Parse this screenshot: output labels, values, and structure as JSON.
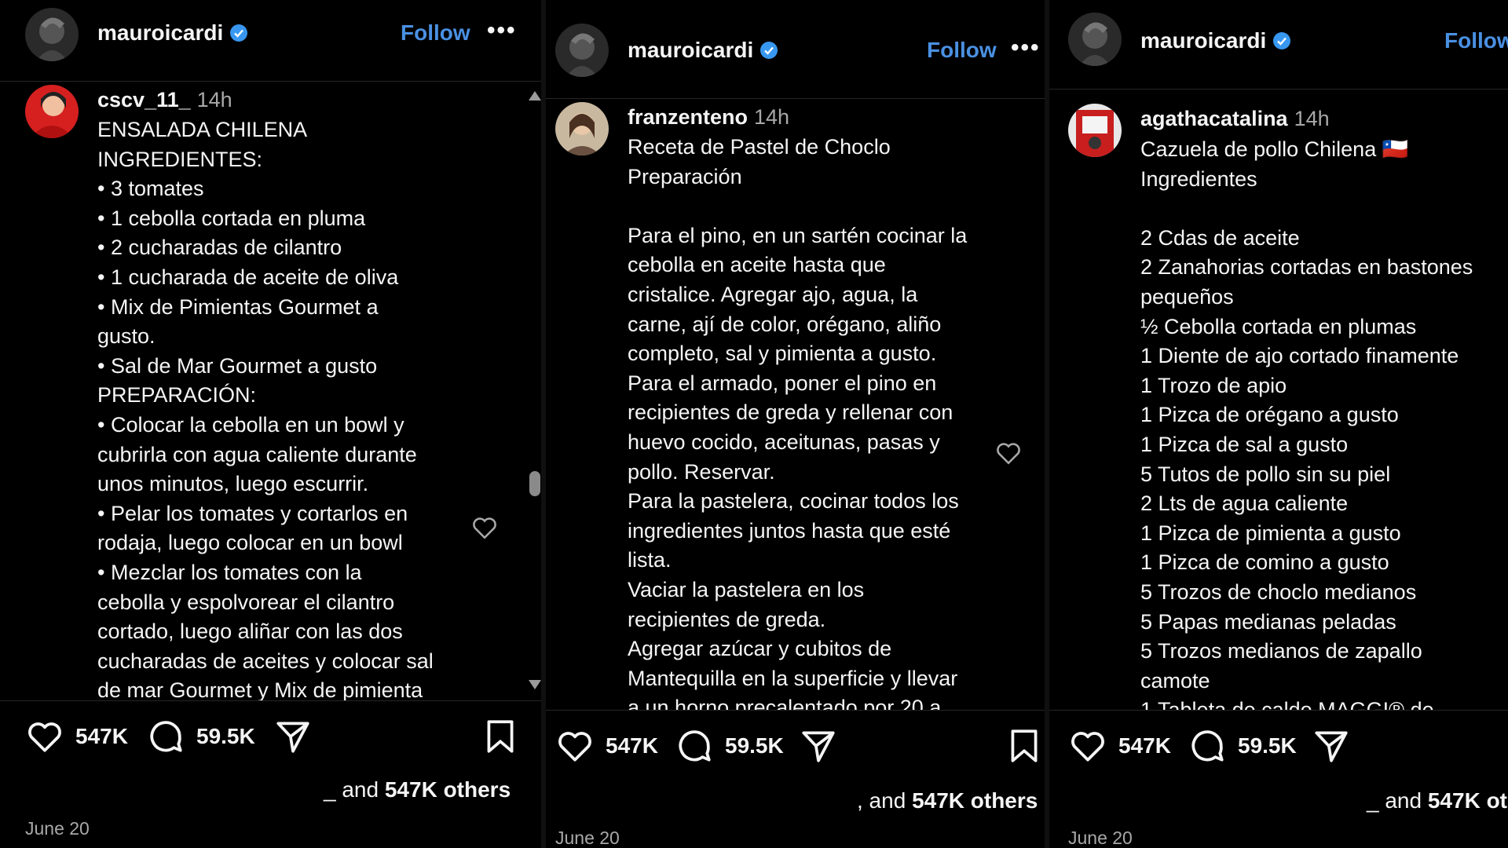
{
  "panels": [
    {
      "post_author": "mauroicardi",
      "follow_label": "Follow",
      "more_label": "•••",
      "comment": {
        "user": "cscv_11_",
        "time": "14h",
        "text": "ENSALADA CHILENA\nINGREDIENTES:\n• 3 tomates\n• 1 cebolla cortada en pluma\n• 2 cucharadas de cilantro\n• 1 cucharada de aceite de oliva\n• Mix de Pimientas Gourmet a\ngusto.\n• Sal de Mar Gourmet a gusto\nPREPARACIÓN:\n• Colocar la cebolla en un bowl y\ncubrirla con agua caliente durante\nunos minutos, luego escurrir.\n• Pelar los tomates y cortarlos en\nrodaja, luego colocar en un bowl\n• Mezclar los tomates con la\ncebolla y espolvorear el cilantro\ncortado, luego aliñar con las dos\ncucharadas de aceites y colocar sal\nde mar Gourmet y Mix de pimienta"
      },
      "likes": "547K",
      "comments_count": "59.5K",
      "liked_by_prefix": "_ and ",
      "liked_by_count": "547K others",
      "date": "June 20"
    },
    {
      "post_author": "mauroicardi",
      "follow_label": "Follow",
      "more_label": "•••",
      "comment": {
        "user": "franzenteno",
        "time": "14h",
        "text": "Receta de Pastel de Choclo\nPreparación\n\nPara el pino, en un sartén cocinar la\ncebolla en aceite hasta que\ncristalice. Agregar ajo, agua, la\ncarne, ají de color, orégano, aliño\ncompleto, sal y pimienta a gusto.\nPara el armado, poner el pino en\nrecipientes de greda y rellenar con\nhuevo cocido, aceitunas, pasas y\npollo. Reservar.\nPara la pastelera, cocinar todos los\ningredientes juntos hasta que esté\nlista.\nVaciar la pastelera en los\nrecipientes de greda.\nAgregar azúcar y cubitos de\nMantequilla en la superficie y llevar\na un horno precalentado por 20 a"
      },
      "likes": "547K",
      "comments_count": "59.5K",
      "liked_by_prefix": ", and ",
      "liked_by_count": "547K others",
      "date": "June 20"
    },
    {
      "post_author": "mauroicardi",
      "follow_label": "Follow",
      "comment": {
        "user": "agathacatalina",
        "time": "14h",
        "text": "Cazuela de pollo Chilena 🇨🇱\nIngredientes\n\n2 Cdas de aceite\n2 Zanahorias cortadas en bastones\npequeños\n½ Cebolla cortada en plumas\n1 Diente de ajo cortado finamente\n1 Trozo de apio\n1 Pizca de orégano a gusto\n1 Pizca de sal a gusto\n5 Tutos de pollo sin su piel\n2 Lts de agua caliente\n1 Pizca de pimienta a gusto\n1 Pizca de comino a gusto\n5 Trozos de choclo medianos\n5 Papas medianas peladas\n5 Trozos medianos de zapallo\ncamote\n1 Tableta de caldo MAGGI® de"
      },
      "likes": "547K",
      "comments_count": "59.5K",
      "liked_by_prefix": "_ and ",
      "liked_by_count": "547K ot",
      "date": "June 20"
    }
  ],
  "colors": {
    "background": "#000000",
    "text": "#f5f5f5",
    "muted": "#a8a8a8",
    "link": "#4a90e2",
    "verified": "#3897f0"
  },
  "icons": [
    "verified-badge-icon",
    "heart-icon",
    "comment-icon",
    "share-icon",
    "bookmark-icon",
    "more-icon"
  ]
}
